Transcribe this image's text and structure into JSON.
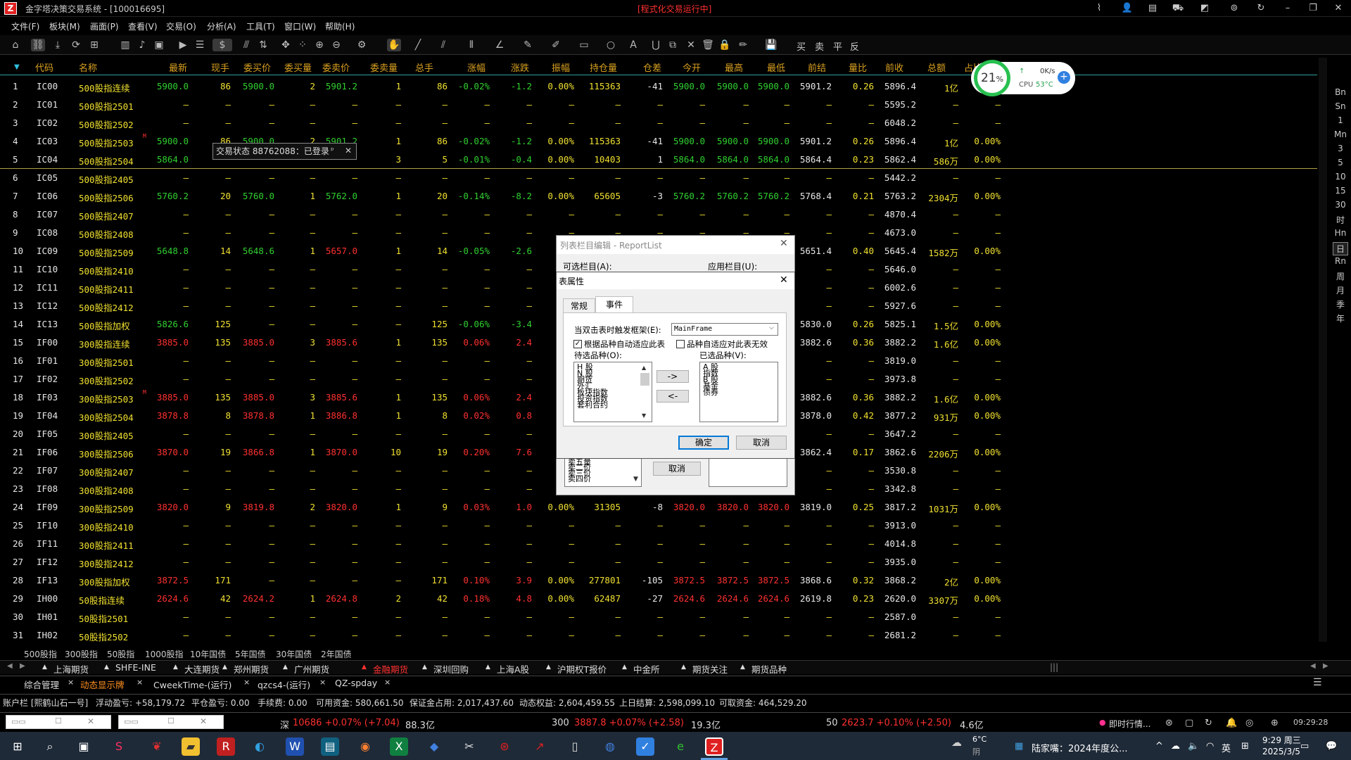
{
  "title_bar": {
    "logo": "Z",
    "app_title": "金字塔决策交易系统 - [100016695]",
    "status": "[程式化交易运行中]"
  },
  "menu": [
    "文件(F)",
    "板块(M)",
    "画面(P)",
    "查看(V)",
    "交易(O)",
    "分析(A)",
    "工具(T)",
    "窗口(W)",
    "帮助(H)"
  ],
  "toolbar": {
    "trade_labels": [
      "买",
      "卖",
      "平",
      "反"
    ]
  },
  "columns": [
    "代码",
    "名称",
    "最新",
    "现手",
    "委买价",
    "委买量",
    "委卖价",
    "委卖量",
    "总手",
    "涨幅",
    "涨跌",
    "振幅",
    "持仓量",
    "仓差",
    "今开",
    "最高",
    "最低",
    "前结",
    "量比",
    "前收",
    "总额",
    "占比"
  ],
  "rows": [
    {
      "no": "1",
      "code": "IC00",
      "name": "500股指连续",
      "flag": "",
      "last": "5900.0",
      "hand": "86",
      "bid": "5900.0",
      "bidv": "2",
      "ask": "5901.2",
      "askv": "1",
      "vol": "86",
      "pct": "-0.02%",
      "chg": "-1.2",
      "amp": "0.00%",
      "oi": "115363",
      "oid": "-41",
      "open": "5900.0",
      "high": "5900.0",
      "low": "5900.0",
      "pset": "5901.2",
      "vr": "0.26",
      "pclose": "5896.4",
      "amt": "1亿",
      "ratio": "",
      "tone": "grn"
    },
    {
      "no": "2",
      "code": "IC01",
      "name": "500股指2501",
      "flag": "",
      "last": "—",
      "hand": "—",
      "bid": "—",
      "bidv": "—",
      "ask": "—",
      "askv": "—",
      "vol": "—",
      "pct": "—",
      "chg": "—",
      "amp": "—",
      "oi": "—",
      "oid": "—",
      "open": "—",
      "high": "—",
      "low": "—",
      "pset": "—",
      "vr": "—",
      "pclose": "5595.2",
      "amt": "—",
      "ratio": "—",
      "tone": "none"
    },
    {
      "no": "3",
      "code": "IC02",
      "name": "500股指2502",
      "flag": "",
      "last": "—",
      "hand": "—",
      "bid": "—",
      "bidv": "—",
      "ask": "—",
      "askv": "—",
      "vol": "—",
      "pct": "—",
      "chg": "—",
      "amp": "—",
      "oi": "—",
      "oid": "—",
      "open": "—",
      "high": "—",
      "low": "—",
      "pset": "—",
      "vr": "—",
      "pclose": "6048.2",
      "amt": "—",
      "ratio": "—",
      "tone": "none"
    },
    {
      "no": "4",
      "code": "IC03",
      "name": "500股指2503",
      "flag": "M",
      "last": "5900.0",
      "hand": "86",
      "bid": "5900.0",
      "bidv": "2",
      "ask": "5901.2",
      "askv": "1",
      "vol": "86",
      "pct": "-0.02%",
      "chg": "-1.2",
      "amp": "0.00%",
      "oi": "115363",
      "oid": "-41",
      "open": "5900.0",
      "high": "5900.0",
      "low": "5900.0",
      "pset": "5901.2",
      "vr": "0.26",
      "pclose": "5896.4",
      "amt": "1亿",
      "ratio": "0.00%",
      "tone": "grn"
    },
    {
      "no": "5",
      "code": "IC04",
      "name": "500股指2504",
      "flag": "",
      "last": "5864.0",
      "hand": "",
      "bid": "",
      "bidv": "",
      "ask": "",
      "askv": "3",
      "vol": "5",
      "pct": "-0.01%",
      "chg": "-0.4",
      "amp": "0.00%",
      "oi": "10403",
      "oid": "1",
      "open": "5864.0",
      "high": "5864.0",
      "low": "5864.0",
      "pset": "5864.4",
      "vr": "0.23",
      "pclose": "5862.4",
      "amt": "586万",
      "ratio": "0.00%",
      "tone": "grn"
    },
    {
      "no": "6",
      "code": "IC05",
      "name": "500股指2405",
      "flag": "",
      "last": "—",
      "hand": "—",
      "bid": "—",
      "bidv": "—",
      "ask": "—",
      "askv": "—",
      "vol": "—",
      "pct": "—",
      "chg": "—",
      "amp": "—",
      "oi": "—",
      "oid": "—",
      "open": "—",
      "high": "—",
      "low": "—",
      "pset": "—",
      "vr": "—",
      "pclose": "5442.2",
      "amt": "—",
      "ratio": "—",
      "tone": "none"
    },
    {
      "no": "7",
      "code": "IC06",
      "name": "500股指2506",
      "flag": "",
      "last": "5760.2",
      "hand": "20",
      "bid": "5760.0",
      "bidv": "1",
      "ask": "5762.0",
      "askv": "1",
      "vol": "20",
      "pct": "-0.14%",
      "chg": "-8.2",
      "amp": "0.00%",
      "oi": "65605",
      "oid": "-3",
      "open": "5760.2",
      "high": "5760.2",
      "low": "5760.2",
      "pset": "5768.4",
      "vr": "0.21",
      "pclose": "5763.2",
      "amt": "2304万",
      "ratio": "0.00%",
      "tone": "grn"
    },
    {
      "no": "8",
      "code": "IC07",
      "name": "500股指2407",
      "flag": "",
      "last": "—",
      "hand": "—",
      "bid": "—",
      "bidv": "—",
      "ask": "—",
      "askv": "—",
      "vol": "—",
      "pct": "—",
      "chg": "—",
      "amp": "—",
      "oi": "—",
      "oid": "—",
      "open": "—",
      "high": "—",
      "low": "—",
      "pset": "—",
      "vr": "—",
      "pclose": "4870.4",
      "amt": "—",
      "ratio": "—",
      "tone": "none"
    },
    {
      "no": "9",
      "code": "IC08",
      "name": "500股指2408",
      "flag": "",
      "last": "—",
      "hand": "—",
      "bid": "—",
      "bidv": "—",
      "ask": "—",
      "askv": "—",
      "vol": "—",
      "pct": "—",
      "chg": "—",
      "amp": "—",
      "oi": "—",
      "oid": "—",
      "open": "—",
      "high": "—",
      "low": "—",
      "pset": "—",
      "vr": "—",
      "pclose": "4673.0",
      "amt": "—",
      "ratio": "—",
      "tone": "none"
    },
    {
      "no": "10",
      "code": "IC09",
      "name": "500股指2509",
      "flag": "",
      "last": "5648.8",
      "hand": "14",
      "bid": "5648.6",
      "bidv": "1",
      "ask": "5657.0",
      "askv": "1",
      "vol": "14",
      "pct": "-0.05%",
      "chg": "-2.6",
      "amp": "0.",
      "oi": "",
      "oid": "",
      "open": "",
      "high": "",
      "low": "",
      "pset": "5651.4",
      "vr": "0.40",
      "pclose": "5645.4",
      "amt": "1582万",
      "ratio": "0.00%",
      "tone": "grn",
      "ask_red": true
    },
    {
      "no": "11",
      "code": "IC10",
      "name": "500股指2410",
      "flag": "",
      "last": "—",
      "hand": "—",
      "bid": "—",
      "bidv": "—",
      "ask": "—",
      "askv": "—",
      "vol": "—",
      "pct": "—",
      "chg": "—",
      "amp": "",
      "oi": "",
      "oid": "",
      "open": "",
      "high": "",
      "low": "",
      "pset": "—",
      "vr": "—",
      "pclose": "5646.0",
      "amt": "—",
      "ratio": "—",
      "tone": "none"
    },
    {
      "no": "12",
      "code": "IC11",
      "name": "500股指2411",
      "flag": "",
      "last": "—",
      "hand": "—",
      "bid": "—",
      "bidv": "—",
      "ask": "—",
      "askv": "—",
      "vol": "—",
      "pct": "—",
      "chg": "—",
      "amp": "",
      "oi": "",
      "oid": "",
      "open": "",
      "high": "",
      "low": "",
      "pset": "—",
      "vr": "—",
      "pclose": "6002.6",
      "amt": "—",
      "ratio": "—",
      "tone": "none"
    },
    {
      "no": "13",
      "code": "IC12",
      "name": "500股指2412",
      "flag": "",
      "last": "—",
      "hand": "—",
      "bid": "—",
      "bidv": "—",
      "ask": "—",
      "askv": "—",
      "vol": "—",
      "pct": "—",
      "chg": "—",
      "amp": "",
      "oi": "",
      "oid": "",
      "open": "",
      "high": "",
      "low": "",
      "pset": "—",
      "vr": "—",
      "pclose": "5927.6",
      "amt": "—",
      "ratio": "—",
      "tone": "none"
    },
    {
      "no": "14",
      "code": "IC13",
      "name": "500股指加权",
      "flag": "",
      "last": "5826.6",
      "hand": "125",
      "bid": "—",
      "bidv": "—",
      "ask": "—",
      "askv": "—",
      "vol": "125",
      "pct": "-0.06%",
      "chg": "-3.4",
      "amp": "0.",
      "oi": "",
      "oid": "",
      "open": "",
      "high": "",
      "low": "",
      "pset": "5830.0",
      "vr": "0.26",
      "pclose": "5825.1",
      "amt": "1.5亿",
      "ratio": "0.00%",
      "tone": "grn"
    },
    {
      "no": "15",
      "code": "IF00",
      "name": "300股指连续",
      "flag": "",
      "last": "3885.0",
      "hand": "135",
      "bid": "3885.0",
      "bidv": "3",
      "ask": "3885.6",
      "askv": "1",
      "vol": "135",
      "pct": "0.06%",
      "chg": "2.4",
      "amp": "0.",
      "oi": "",
      "oid": "",
      "open": "",
      "high": "",
      "low": "",
      "pset": "3882.6",
      "vr": "0.36",
      "pclose": "3882.2",
      "amt": "1.6亿",
      "ratio": "0.00%",
      "tone": "red"
    },
    {
      "no": "16",
      "code": "IF01",
      "name": "300股指2501",
      "flag": "",
      "last": "—",
      "hand": "—",
      "bid": "—",
      "bidv": "—",
      "ask": "—",
      "askv": "—",
      "vol": "—",
      "pct": "—",
      "chg": "—",
      "amp": "",
      "oi": "",
      "oid": "",
      "open": "",
      "high": "",
      "low": "",
      "pset": "—",
      "vr": "—",
      "pclose": "3819.0",
      "amt": "—",
      "ratio": "—",
      "tone": "none"
    },
    {
      "no": "17",
      "code": "IF02",
      "name": "300股指2502",
      "flag": "",
      "last": "—",
      "hand": "—",
      "bid": "—",
      "bidv": "—",
      "ask": "—",
      "askv": "—",
      "vol": "—",
      "pct": "—",
      "chg": "—",
      "amp": "",
      "oi": "",
      "oid": "",
      "open": "",
      "high": "",
      "low": "",
      "pset": "—",
      "vr": "—",
      "pclose": "3973.8",
      "amt": "—",
      "ratio": "—",
      "tone": "none"
    },
    {
      "no": "18",
      "code": "IF03",
      "name": "300股指2503",
      "flag": "M",
      "last": "3885.0",
      "hand": "135",
      "bid": "3885.0",
      "bidv": "3",
      "ask": "3885.6",
      "askv": "1",
      "vol": "135",
      "pct": "0.06%",
      "chg": "2.4",
      "amp": "0.",
      "oi": "",
      "oid": "",
      "open": "",
      "high": "",
      "low": "",
      "pset": "3882.6",
      "vr": "0.36",
      "pclose": "3882.2",
      "amt": "1.6亿",
      "ratio": "0.00%",
      "tone": "red"
    },
    {
      "no": "19",
      "code": "IF04",
      "name": "300股指2504",
      "flag": "",
      "last": "3878.8",
      "hand": "8",
      "bid": "3878.8",
      "bidv": "1",
      "ask": "3886.8",
      "askv": "1",
      "vol": "8",
      "pct": "0.02%",
      "chg": "0.8",
      "amp": "0.",
      "oi": "",
      "oid": "",
      "open": "",
      "high": "",
      "low": "",
      "pset": "3878.0",
      "vr": "0.42",
      "pclose": "3877.2",
      "amt": "931万",
      "ratio": "0.00%",
      "tone": "red"
    },
    {
      "no": "20",
      "code": "IF05",
      "name": "300股指2405",
      "flag": "",
      "last": "—",
      "hand": "—",
      "bid": "—",
      "bidv": "—",
      "ask": "—",
      "askv": "—",
      "vol": "—",
      "pct": "—",
      "chg": "—",
      "amp": "",
      "oi": "",
      "oid": "",
      "open": "",
      "high": "",
      "low": "",
      "pset": "—",
      "vr": "—",
      "pclose": "3647.2",
      "amt": "—",
      "ratio": "—",
      "tone": "none"
    },
    {
      "no": "21",
      "code": "IF06",
      "name": "300股指2506",
      "flag": "",
      "last": "3870.0",
      "hand": "19",
      "bid": "3866.8",
      "bidv": "1",
      "ask": "3870.0",
      "askv": "10",
      "vol": "19",
      "pct": "0.20%",
      "chg": "7.6",
      "amp": "0.",
      "oi": "",
      "oid": "",
      "open": "",
      "high": "",
      "low": "",
      "pset": "3862.4",
      "vr": "0.17",
      "pclose": "3862.6",
      "amt": "2206万",
      "ratio": "0.00%",
      "tone": "red"
    },
    {
      "no": "22",
      "code": "IF07",
      "name": "300股指2407",
      "flag": "",
      "last": "—",
      "hand": "—",
      "bid": "—",
      "bidv": "—",
      "ask": "—",
      "askv": "—",
      "vol": "—",
      "pct": "—",
      "chg": "—",
      "amp": "",
      "oi": "",
      "oid": "",
      "open": "",
      "high": "",
      "low": "",
      "pset": "—",
      "vr": "—",
      "pclose": "3530.8",
      "amt": "—",
      "ratio": "—",
      "tone": "none"
    },
    {
      "no": "23",
      "code": "IF08",
      "name": "300股指2408",
      "flag": "",
      "last": "—",
      "hand": "—",
      "bid": "—",
      "bidv": "—",
      "ask": "—",
      "askv": "—",
      "vol": "—",
      "pct": "—",
      "chg": "—",
      "amp": "",
      "oi": "",
      "oid": "",
      "open": "",
      "high": "",
      "low": "",
      "pset": "—",
      "vr": "—",
      "pclose": "3342.8",
      "amt": "—",
      "ratio": "—",
      "tone": "none"
    },
    {
      "no": "24",
      "code": "IF09",
      "name": "300股指2509",
      "flag": "",
      "last": "3820.0",
      "hand": "9",
      "bid": "3819.8",
      "bidv": "2",
      "ask": "3820.0",
      "askv": "1",
      "vol": "9",
      "pct": "0.03%",
      "chg": "1.0",
      "amp": "0.00%",
      "oi": "31305",
      "oid": "-8",
      "open": "3820.0",
      "high": "3820.0",
      "low": "3820.0",
      "pset": "3819.0",
      "vr": "0.25",
      "pclose": "3817.2",
      "amt": "1031万",
      "ratio": "0.00%",
      "tone": "red"
    },
    {
      "no": "25",
      "code": "IF10",
      "name": "300股指2410",
      "flag": "",
      "last": "—",
      "hand": "—",
      "bid": "—",
      "bidv": "—",
      "ask": "—",
      "askv": "—",
      "vol": "—",
      "pct": "—",
      "chg": "—",
      "amp": "—",
      "oi": "—",
      "oid": "—",
      "open": "—",
      "high": "—",
      "low": "—",
      "pset": "—",
      "vr": "—",
      "pclose": "3913.0",
      "amt": "—",
      "ratio": "—",
      "tone": "none"
    },
    {
      "no": "26",
      "code": "IF11",
      "name": "300股指2411",
      "flag": "",
      "last": "—",
      "hand": "—",
      "bid": "—",
      "bidv": "—",
      "ask": "—",
      "askv": "—",
      "vol": "—",
      "pct": "—",
      "chg": "—",
      "amp": "—",
      "oi": "—",
      "oid": "—",
      "open": "—",
      "high": "—",
      "low": "—",
      "pset": "—",
      "vr": "—",
      "pclose": "4014.8",
      "amt": "—",
      "ratio": "—",
      "tone": "none"
    },
    {
      "no": "27",
      "code": "IF12",
      "name": "300股指2412",
      "flag": "",
      "last": "—",
      "hand": "—",
      "bid": "—",
      "bidv": "—",
      "ask": "—",
      "askv": "—",
      "vol": "—",
      "pct": "—",
      "chg": "—",
      "amp": "—",
      "oi": "—",
      "oid": "—",
      "open": "—",
      "high": "—",
      "low": "—",
      "pset": "—",
      "vr": "—",
      "pclose": "3935.0",
      "amt": "—",
      "ratio": "—",
      "tone": "none"
    },
    {
      "no": "28",
      "code": "IF13",
      "name": "300股指加权",
      "flag": "",
      "last": "3872.5",
      "hand": "171",
      "bid": "—",
      "bidv": "—",
      "ask": "—",
      "askv": "—",
      "vol": "171",
      "pct": "0.10%",
      "chg": "3.9",
      "amp": "0.00%",
      "oi": "277801",
      "oid": "-105",
      "open": "3872.5",
      "high": "3872.5",
      "low": "3872.5",
      "pset": "3868.6",
      "vr": "0.32",
      "pclose": "3868.2",
      "amt": "2亿",
      "ratio": "0.00%",
      "tone": "red"
    },
    {
      "no": "29",
      "code": "IH00",
      "name": "50股指连续",
      "flag": "",
      "last": "2624.6",
      "hand": "42",
      "bid": "2624.2",
      "bidv": "1",
      "ask": "2624.8",
      "askv": "2",
      "vol": "42",
      "pct": "0.18%",
      "chg": "4.8",
      "amp": "0.00%",
      "oi": "62487",
      "oid": "-27",
      "open": "2624.6",
      "high": "2624.6",
      "low": "2624.6",
      "pset": "2619.8",
      "vr": "0.23",
      "pclose": "2620.0",
      "amt": "3307万",
      "ratio": "0.00%",
      "tone": "red"
    },
    {
      "no": "30",
      "code": "IH01",
      "name": "50股指2501",
      "flag": "",
      "last": "—",
      "hand": "—",
      "bid": "—",
      "bidv": "—",
      "ask": "—",
      "askv": "—",
      "vol": "—",
      "pct": "—",
      "chg": "—",
      "amp": "—",
      "oi": "—",
      "oid": "—",
      "open": "—",
      "high": "—",
      "low": "—",
      "pset": "—",
      "vr": "—",
      "pclose": "2587.0",
      "amt": "—",
      "ratio": "—",
      "tone": "none"
    },
    {
      "no": "31",
      "code": "IH02",
      "name": "50股指2502",
      "flag": "",
      "last": "—",
      "hand": "—",
      "bid": "—",
      "bidv": "—",
      "ask": "—",
      "askv": "—",
      "vol": "—",
      "pct": "—",
      "chg": "—",
      "amp": "—",
      "oi": "—",
      "oid": "—",
      "open": "—",
      "high": "—",
      "low": "—",
      "pset": "—",
      "vr": "—",
      "pclose": "2681.2",
      "amt": "—",
      "ratio": "—",
      "tone": "none"
    }
  ],
  "cpu_widget": {
    "percent": "21",
    "percent_sign": "%",
    "net": "0K/s",
    "cpu_label": "CPU",
    "cpu_temp": "53°C"
  },
  "tooltip": {
    "text": "交易状态 88762088：已登录",
    "pin": "ᵖ",
    "close": "✕"
  },
  "dialog_reportlist": {
    "title": "列表栏目编辑 - ReportList",
    "available_label": "可选栏目(A):",
    "applied_label": "应用栏目(U):",
    "list_items": [
      "卖五量",
      "卖二价",
      "卖三价",
      "卖四价"
    ],
    "cancel": "取消"
  },
  "dialog_props": {
    "title": "表属性",
    "tabs": [
      "常规",
      "事件"
    ],
    "dblclick_label": "当双击表时触发框架(E):",
    "frame_value": "MainFrame",
    "auto_adapt_label": "根据品种自动适应此表",
    "disable_label": "品种自适应对此表无效",
    "pending_label": "待选品种(O):",
    "selected_label": "已选品种(V):",
    "pending_items": [
      "H 股",
      "N 股",
      "期货",
      "外汇",
      "板块指数",
      "投资指数",
      "套利合约"
    ],
    "selected_items": [
      "A 股",
      "指数",
      "B 股",
      "基金",
      "债券"
    ],
    "add_btn": "->",
    "remove_btn": "<-",
    "ok": "确定",
    "cancel": "取消"
  },
  "sub_tabs": [
    "500股指",
    "300股指",
    "50股指",
    "1000股指",
    "10年国债",
    "5年国债",
    "30年国债",
    "2年国债"
  ],
  "market_tabs": [
    "上海期货",
    "SHFE-INE",
    "大连期货",
    "郑州期货",
    "广州期货",
    "金融期货",
    "深圳回购",
    "上海A股",
    "沪期权T报价",
    "中金所",
    "期货关注",
    "期货品种"
  ],
  "market_active": "金融期货",
  "window_tabs": [
    {
      "label": "综合管理",
      "active": false
    },
    {
      "label": "动态显示牌",
      "active": true
    },
    {
      "label": "CweekTime-(运行)",
      "active": false
    },
    {
      "label": "qzcs4-(运行)",
      "active": false
    },
    {
      "label": "QZ-spday",
      "active": false
    }
  ],
  "account": {
    "name": "账户栏 [熙鹤山石一号]",
    "float_pl": "浮动盈亏: +58,179.72",
    "close_pl": "平仓盈亏: 0.00",
    "fee": "手续费: 0.00",
    "available": "可用资金: 580,661.50",
    "margin": "保证金占用: 2,017,437.60",
    "equity": "动态权益: 2,604,459.55",
    "prev_settle": "上日结算: 2,598,099.10",
    "withdrawable": "可取资金: 464,529.20"
  },
  "index_bar": {
    "sz_label": "深",
    "sz_value": "10686 +0.07% (+7.04)",
    "sz_amt": "88.3亿",
    "hs300_label": "300",
    "hs300_value": "3887.8 +0.07% (+2.58)",
    "hs300_amt": "19.3亿",
    "sz50_label": "50",
    "sz50_value": "2623.7 +0.10% (+2.50)",
    "sz50_amt": "4.6亿",
    "realtime": "即时行情...",
    "clock": "09:29:28"
  },
  "right_bar": [
    "Bn",
    "Sn",
    "1",
    "Mn",
    "3",
    "5",
    "10",
    "15",
    "30",
    "时",
    "Hn",
    "日",
    "Rn",
    "周",
    "月",
    "季",
    "年"
  ],
  "taskbar": {
    "weather_temp": "6°C",
    "weather_desc": "阴",
    "news": "陆家嘴：2024年度公...",
    "ime": "英",
    "time": "9:29 周三",
    "date": "2025/3/5"
  },
  "colors": {
    "up": "#ff3030",
    "down": "#30d030",
    "code": "#f0e030",
    "header": "#d8a020"
  }
}
